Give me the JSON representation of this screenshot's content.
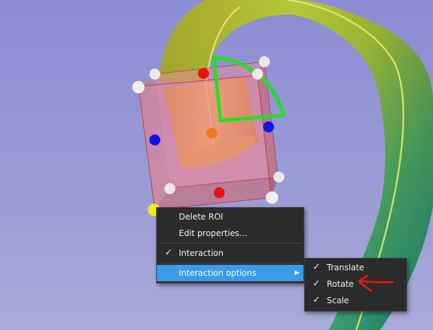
{
  "context_menu": {
    "items": [
      {
        "label": "Delete ROI",
        "checked": false
      },
      {
        "label": "Edit properties...",
        "checked": false
      },
      {
        "label": "Interaction",
        "checked": true
      },
      {
        "label": "Interaction options",
        "checked": false,
        "has_submenu": true,
        "highlighted": true
      }
    ],
    "check_glyph": "✓",
    "arrow_glyph": "▶"
  },
  "submenu": {
    "items": [
      {
        "label": "Translate",
        "checked": true
      },
      {
        "label": "Rotate",
        "checked": true
      },
      {
        "label": "Scale",
        "checked": true
      }
    ]
  },
  "colors": {
    "background": "#9a9bd6",
    "roi_box": "#e8899a",
    "rotation_handle": "#22e022",
    "annotation_arrow": "#e01818",
    "menu_background": "#2b2b2b",
    "menu_highlight": "#3c9be8"
  },
  "icons": [
    "check-icon",
    "submenu-arrow-icon",
    "annotation-arrow-icon"
  ]
}
